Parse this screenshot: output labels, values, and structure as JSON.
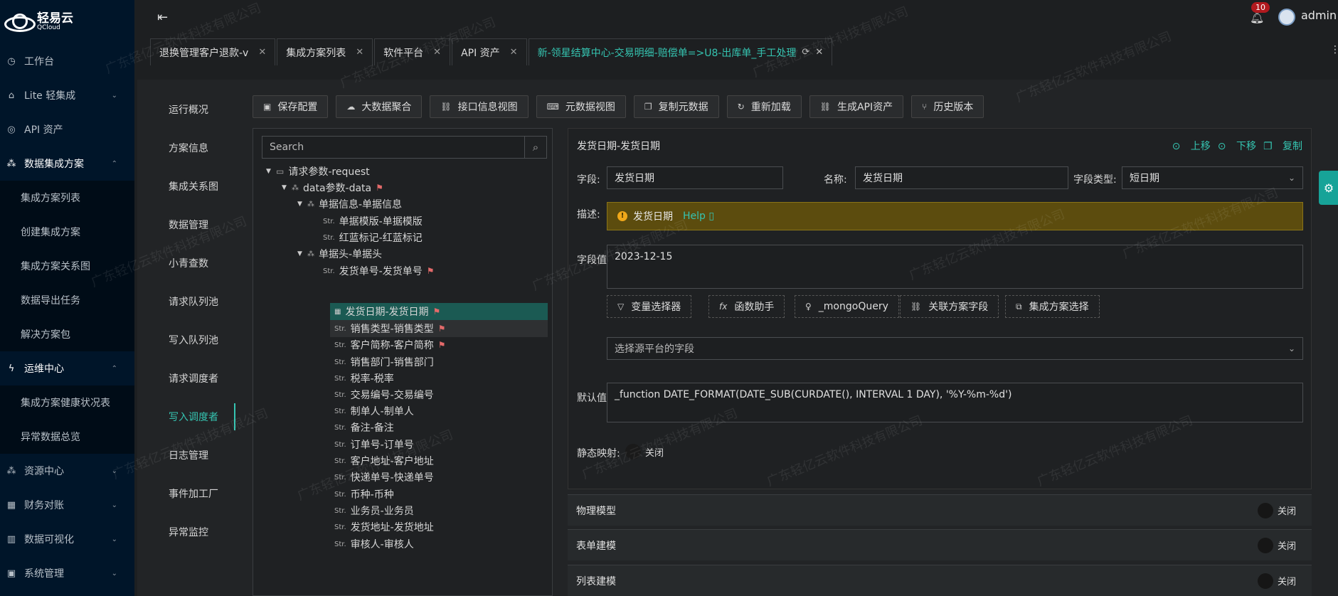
{
  "app": {
    "logo_name": "轻易云",
    "logo_sub": "QCloud"
  },
  "sidebar": {
    "items": [
      {
        "label": "工作台",
        "icon": "clock-icon"
      },
      {
        "label": "Lite 轻集成",
        "icon": "house-icon"
      },
      {
        "label": "API 资产",
        "icon": "compass-icon"
      },
      {
        "label": "数据集成方案",
        "icon": "cluster-icon"
      },
      {
        "label": "集成方案列表",
        "icon": ""
      },
      {
        "label": "创建集成方案",
        "icon": ""
      },
      {
        "label": "集成方案关系图",
        "icon": ""
      },
      {
        "label": "数据导出任务",
        "icon": ""
      },
      {
        "label": "解决方案包",
        "icon": ""
      },
      {
        "label": "运维中心",
        "icon": "bolt-icon"
      },
      {
        "label": "集成方案健康状况表",
        "icon": ""
      },
      {
        "label": "异常数据总览",
        "icon": ""
      },
      {
        "label": "资源中心",
        "icon": "cluster-icon"
      },
      {
        "label": "财务对账",
        "icon": "calculator-icon"
      },
      {
        "label": "数据可视化",
        "icon": "chart-icon"
      },
      {
        "label": "系统管理",
        "icon": "grid-icon"
      }
    ]
  },
  "header": {
    "notification_count": "10",
    "username": "admin"
  },
  "tabs": [
    {
      "label": "退换管理客户退款-v"
    },
    {
      "label": "集成方案列表"
    },
    {
      "label": "软件平台"
    },
    {
      "label": "API 资产"
    },
    {
      "label": "新-领星结算中心-交易明细-赔偿单=>U8-出库单_手工处理"
    }
  ],
  "left_menu": [
    "运行概况",
    "方案信息",
    "集成关系图",
    "数据管理",
    "小青查数",
    "请求队列池",
    "写入队列池",
    "请求调度者",
    "写入调度者",
    "日志管理",
    "事件加工厂",
    "异常监控"
  ],
  "toolbar": [
    {
      "label": "保存配置",
      "icon": "save-icon"
    },
    {
      "label": "大数据聚合",
      "icon": "cloud-icon"
    },
    {
      "label": "接口信息视图",
      "icon": "link-icon"
    },
    {
      "label": "元数据视图",
      "icon": "terminal-icon"
    },
    {
      "label": "复制元数据",
      "icon": "copy-icon"
    },
    {
      "label": "重新加载",
      "icon": "reload-icon"
    },
    {
      "label": "生成API资产",
      "icon": "link-icon"
    },
    {
      "label": "历史版本",
      "icon": "branch-icon"
    }
  ],
  "tree": {
    "search_placeholder": "Search",
    "type_tag": "Str.",
    "nodes": [
      "请求参数-request",
      "data参数-data",
      "单据信息-单据信息",
      "单据模版-单据模版",
      "红蓝标记-红蓝标记",
      "单据头-单据头",
      "发货单号-发货单号",
      "发货日期-发货日期",
      "销售类型-销售类型",
      "客户简称-客户简称",
      "销售部门-销售部门",
      "税率-税率",
      "交易编号-交易编号",
      "制单人-制单人",
      "备注-备注",
      "订单号-订单号",
      "客户地址-客户地址",
      "快递单号-快递单号",
      "币种-币种",
      "业务员-业务员",
      "发货地址-发货地址",
      "审核人-审核人"
    ]
  },
  "detail": {
    "title": "发货日期-发货日期",
    "actions": {
      "up": "上移",
      "down": "下移",
      "copy": "复制"
    },
    "field_label": "字段:",
    "field_value": "发货日期",
    "name_label": "名称:",
    "name_value": "发货日期",
    "type_label": "字段类型:",
    "type_value": "短日期",
    "desc_label": "描述:",
    "desc_text": "发货日期",
    "help_text": "Help",
    "value_label": "字段值:",
    "value_text": "2023-12-15",
    "helper_buttons": [
      "变量选择器",
      "函数助手",
      "_mongoQuery",
      "关联方案字段",
      "集成方案选择"
    ],
    "source_placeholder": "选择源平台的字段",
    "default_label": "默认值:",
    "default_text": "_function DATE_FORMAT(DATE_SUB(CURDATE(), INTERVAL 1 DAY), '%Y-%m-%d')",
    "static_label": "静态映射:",
    "static_state": "关闭"
  },
  "sections": [
    {
      "label": "物理模型",
      "state": "关闭"
    },
    {
      "label": "表单建模",
      "state": "关闭"
    },
    {
      "label": "列表建模",
      "state": "关闭"
    }
  ],
  "watermark": "广东轻亿云软件科技有限公司"
}
